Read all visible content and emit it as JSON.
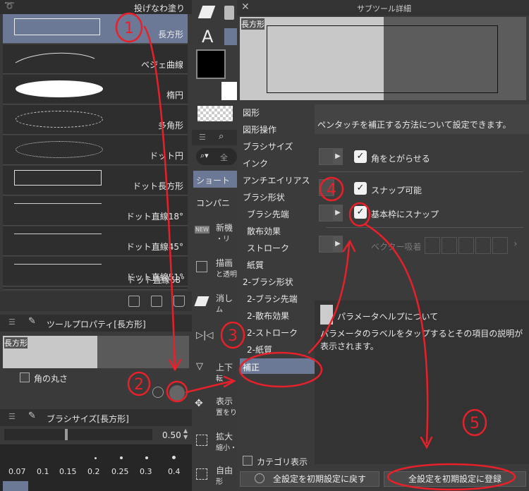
{
  "left_panel": {
    "shapes": [
      {
        "label": "投げなわ塗り"
      },
      {
        "label": "長方形"
      },
      {
        "label": "ベジェ曲線"
      },
      {
        "label": "楕円"
      },
      {
        "label": "多角形"
      },
      {
        "label": "ドット円"
      },
      {
        "label": "ドット長方形"
      },
      {
        "label": "ドット直線18°"
      },
      {
        "label": "ドット直線45°"
      },
      {
        "label": "ドット直線51°"
      },
      {
        "label": "ドット直線68°"
      }
    ],
    "tool_property": {
      "title": "ツールプロパティ[長方形]",
      "preview_label": "長方形",
      "corner_round_label": "角の丸さ"
    },
    "brush_size": {
      "title": "ブラシサイズ[長方形]",
      "value": "0.50",
      "presets": [
        "0.07",
        "0.1",
        "0.15",
        "0.2",
        "0.25",
        "0.3",
        "0.4"
      ]
    }
  },
  "mid_panel": {
    "letter_a": "A",
    "shortcut_tab": "ショート",
    "compani_tab": "コンパニ",
    "search_placeholder": "全",
    "new_badge": "NEW",
    "items": [
      {
        "title": "新機",
        "sub": "・リ"
      },
      {
        "title": "描画",
        "sub": "と透明"
      },
      {
        "title": "消し",
        "sub": "ム"
      },
      {
        "title": "上下",
        "sub": "転"
      },
      {
        "title": "表示",
        "sub": "置をり"
      },
      {
        "title": "拡大",
        "sub": "縮小・"
      },
      {
        "title": "自由",
        "sub": "形"
      }
    ]
  },
  "dialog": {
    "title": "サブツール詳細",
    "preview_label": "長方形",
    "categories": [
      "図形",
      "図形操作",
      "ブラシサイズ",
      "インク",
      "アンチエイリアス",
      "ブラシ形状",
      "ブラシ先端",
      "散布効果",
      "ストローク",
      "紙質",
      "2-ブラシ形状",
      "2-ブラシ先端",
      "2-散布効果",
      "2-ストローク",
      "2-紙質",
      "補正"
    ],
    "description": "ペンタッチを補正する方法について設定できます。",
    "options": {
      "sharp_corners": "角をとがらせる",
      "snap": "スナップ可能",
      "snap_base": "基本枠にスナップ",
      "vector_snap": "ベクター吸着"
    },
    "param_help": {
      "title": "パラメータヘルプについて",
      "body": "パラメータのラベルをタップするとその項目の説明が表示されます。"
    },
    "category_display": "カテゴリ表示",
    "reset_button": "全設定を初期設定に戻す",
    "register_button": "全設定を初期設定に登録"
  },
  "annotations": [
    "1",
    "2",
    "3",
    "4",
    "5"
  ],
  "colors": {
    "selection": "#6b7896",
    "annotation": "#e8202a"
  }
}
